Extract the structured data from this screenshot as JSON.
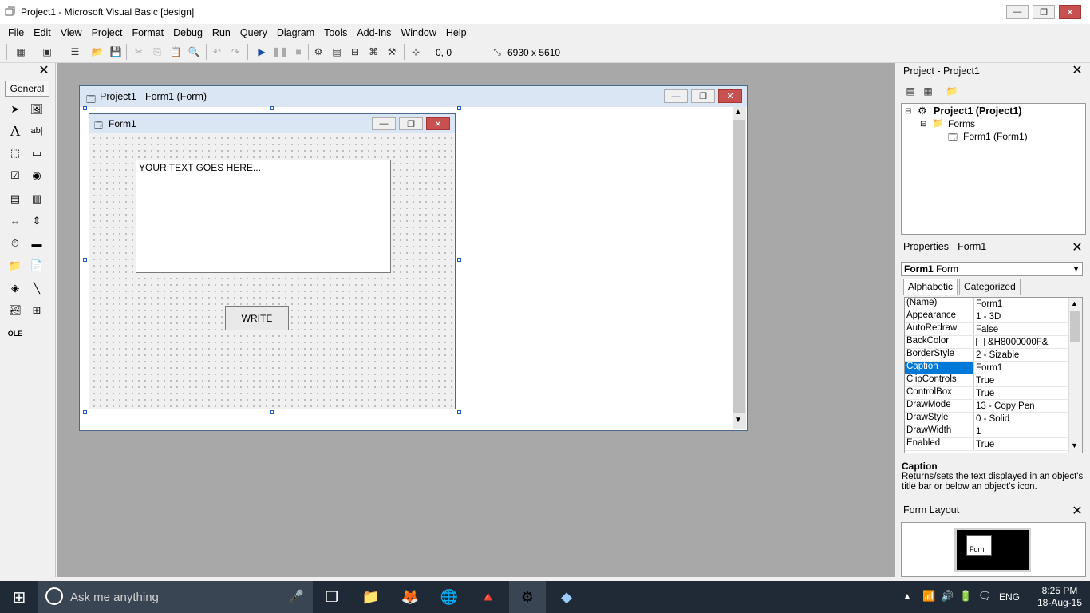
{
  "window": {
    "title": "Project1 - Microsoft Visual Basic [design]",
    "min": "—",
    "max": "❐",
    "close": "✕"
  },
  "menu": [
    "File",
    "Edit",
    "View",
    "Project",
    "Format",
    "Debug",
    "Run",
    "Query",
    "Diagram",
    "Tools",
    "Add-Ins",
    "Window",
    "Help"
  ],
  "toolbar": {
    "position": "0, 0",
    "size": "6930 x 5610"
  },
  "toolbox": {
    "tab": "General",
    "close": "✕"
  },
  "designer": {
    "title": "Project1 - Form1 (Form)"
  },
  "form1": {
    "title": "Form1",
    "textbox_text": "YOUR TEXT GOES HERE...",
    "button_label": "WRITE"
  },
  "project_panel": {
    "title": "Project - Project1",
    "tree": {
      "root": "Project1 (Project1)",
      "folder": "Forms",
      "item": "Form1 (Form1)"
    }
  },
  "properties_panel": {
    "title": "Properties - Form1",
    "object_name": "Form1",
    "object_type": "Form",
    "tabs": [
      "Alphabetic",
      "Categorized"
    ],
    "rows": [
      {
        "name": "(Name)",
        "value": "Form1"
      },
      {
        "name": "Appearance",
        "value": "1 - 3D"
      },
      {
        "name": "AutoRedraw",
        "value": "False"
      },
      {
        "name": "BackColor",
        "value": "&H8000000F&"
      },
      {
        "name": "BorderStyle",
        "value": "2 - Sizable"
      },
      {
        "name": "Caption",
        "value": "Form1"
      },
      {
        "name": "ClipControls",
        "value": "True"
      },
      {
        "name": "ControlBox",
        "value": "True"
      },
      {
        "name": "DrawMode",
        "value": "13 - Copy Pen"
      },
      {
        "name": "DrawStyle",
        "value": "0 - Solid"
      },
      {
        "name": "DrawWidth",
        "value": "1"
      },
      {
        "name": "Enabled",
        "value": "True"
      }
    ],
    "selected": "Caption",
    "desc_title": "Caption",
    "desc_text": "Returns/sets the text displayed in an object's title bar or below an object's icon."
  },
  "layout_panel": {
    "title": "Form Layout",
    "preview_label": "Forn"
  },
  "taskbar": {
    "search_placeholder": "Ask me anything",
    "language": "ENG",
    "time": "8:25 PM",
    "date": "18-Aug-15"
  }
}
